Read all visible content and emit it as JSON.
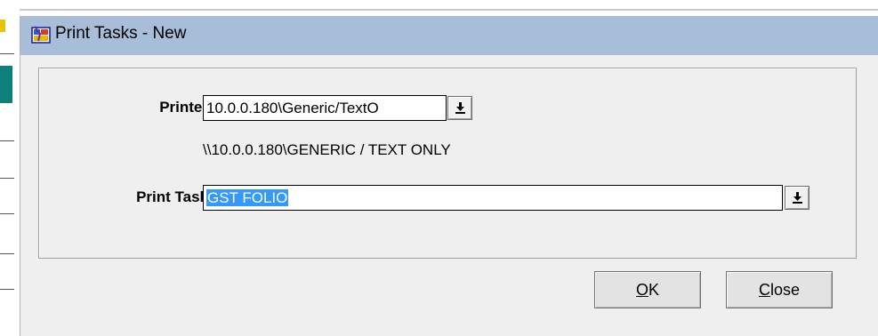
{
  "window": {
    "title": "Print Tasks - New"
  },
  "form": {
    "printer_label": "Printer",
    "printer_value": "10.0.0.180\\Generic/TextO",
    "printer_path": "\\\\10.0.0.180\\GENERIC / TEXT ONLY",
    "print_task_label": "Print Task",
    "print_task_value": "GST FOLIO"
  },
  "buttons": {
    "ok_mnemonic": "O",
    "ok_rest": "K",
    "close_mnemonic": "C",
    "close_rest": "lose"
  },
  "colors": {
    "titlebar": "#a8bdd8",
    "selection": "#3399ff",
    "dialog_bg": "#efefef"
  }
}
